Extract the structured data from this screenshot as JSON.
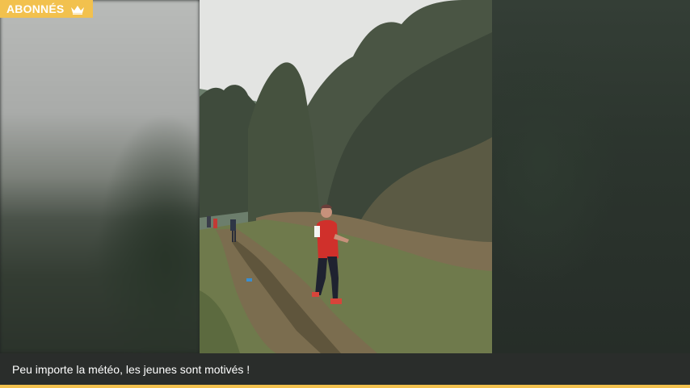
{
  "badge": {
    "label": "ABONNÉS",
    "icon": "crown-icon",
    "color": "#f2c14e"
  },
  "caption": {
    "text": "Peu importe la météo, les jeunes sont motivés !"
  },
  "colors": {
    "accent": "#f2c14e",
    "caption_bg": "#2a2d2b"
  }
}
